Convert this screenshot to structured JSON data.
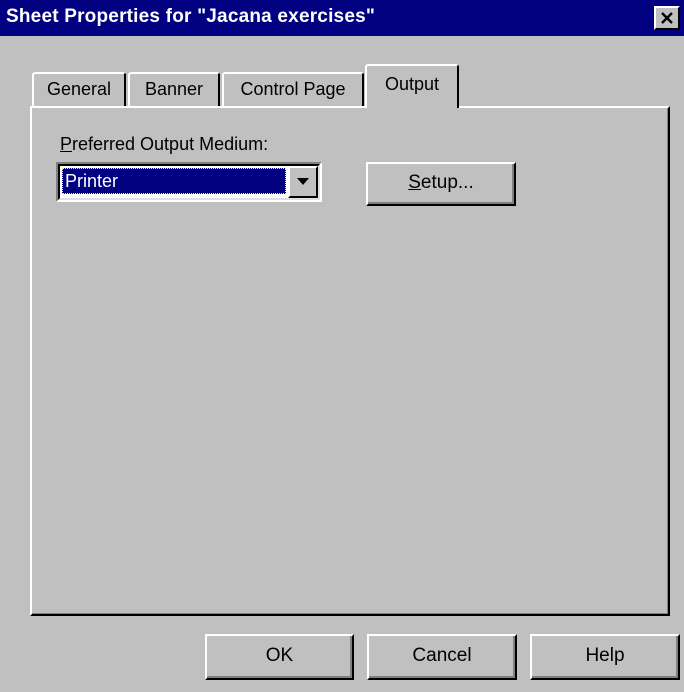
{
  "window": {
    "title": "Sheet Properties for \"Jacana exercises\"",
    "close_icon": "close-icon"
  },
  "tabs": [
    {
      "label": "General",
      "active": false
    },
    {
      "label": "Banner",
      "active": false
    },
    {
      "label": "Control Page",
      "active": false
    },
    {
      "label": "Output",
      "active": true
    }
  ],
  "output_tab": {
    "medium_label_first": "P",
    "medium_label_rest": "referred Output Medium:",
    "medium_value": "Printer",
    "setup_label_first": "S",
    "setup_label_rest": "etup..."
  },
  "footer": {
    "ok_label": "OK",
    "cancel_label": "Cancel",
    "help_label": "Help"
  },
  "colors": {
    "titlebar": "#000080",
    "face": "#c0c0c0",
    "selection": "#000080"
  }
}
